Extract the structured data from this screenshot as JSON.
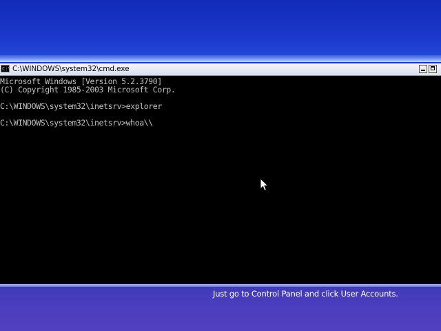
{
  "window": {
    "title": "C:\\WINDOWS\\system32\\cmd.exe",
    "icon_label": "C:\\"
  },
  "console": {
    "lines": [
      "Microsoft Windows [Version 5.2.3790]",
      "(C) Copyright 1985-2003 Microsoft Corp.",
      "",
      "C:\\WINDOWS\\system32\\inetsrv>explorer",
      "",
      "C:\\WINDOWS\\system32\\inetsrv>whoa\\\\"
    ]
  },
  "hint": {
    "text": "Just go to Control Panel and click User Accounts."
  },
  "colors": {
    "desktop": "#1b34c4",
    "console_bg": "#000000",
    "console_fg": "#c0c0c0"
  }
}
